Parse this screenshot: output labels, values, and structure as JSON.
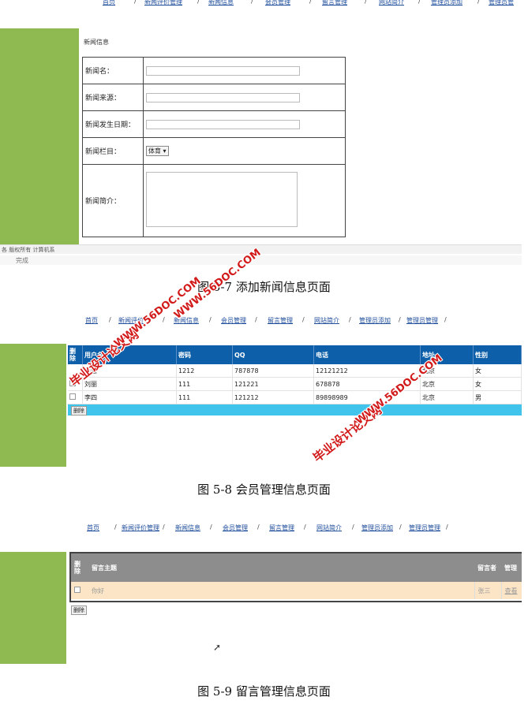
{
  "figure1": {
    "nav": [
      "首页",
      "新闻评价管理",
      "新闻信息",
      "会员管理",
      "留言管理",
      "网站简介",
      "管理员添加",
      "管理员管"
    ],
    "section_title": "新闻信息",
    "fields": {
      "name_label": "新闻名：",
      "source_label": "新闻来源：",
      "date_label": "新闻发生日期：",
      "column_label": "新闻栏目：",
      "column_value": "体育 ▾",
      "intro_label": "新闻简介："
    },
    "footer_copyright": "各 版权所有 计算机系",
    "status_text": "完成",
    "caption": "图 5-7 添加新闻信息页面"
  },
  "figure2": {
    "nav": [
      "首页",
      "新闻评价",
      "新闻信息",
      "会员管理",
      "留言管理",
      "网站简介",
      "管理员添加",
      "管理员管理"
    ],
    "headers": [
      "删除",
      "用户名",
      "密码",
      "QQ",
      "电话",
      "地址",
      "性别"
    ],
    "rows": [
      [
        "李慧",
        "1212",
        "787878",
        "12121212",
        "北京",
        "女"
      ],
      [
        "刘丽",
        "111",
        "121221",
        "678878",
        "北京",
        "女"
      ],
      [
        "李四",
        "111",
        "121212",
        "89898989",
        "北京",
        "男"
      ]
    ],
    "delete_button": "删除",
    "caption": "图 5-8 会员管理信息页面"
  },
  "figure3": {
    "nav": [
      "首页",
      "新闻评价管理",
      "新闻信息",
      "会员管理",
      "留言管理",
      "网站简介",
      "管理员添加",
      "管理员管理"
    ],
    "headers": [
      "删除",
      "留言主题",
      "留言者",
      "管理"
    ],
    "row": [
      "你好",
      "张三",
      "查看"
    ],
    "delete_button": "删除",
    "caption": "图 5-9 留言管理信息页面"
  },
  "watermarks": [
    "毕业设计论文网",
    "WWW.56DOC.COM"
  ],
  "colors": {
    "sidebar_green": "#8fba51",
    "header_blue": "#0c5fa8",
    "msg_row": "#fbe5c6",
    "watermark_red": "#d21a1a"
  }
}
